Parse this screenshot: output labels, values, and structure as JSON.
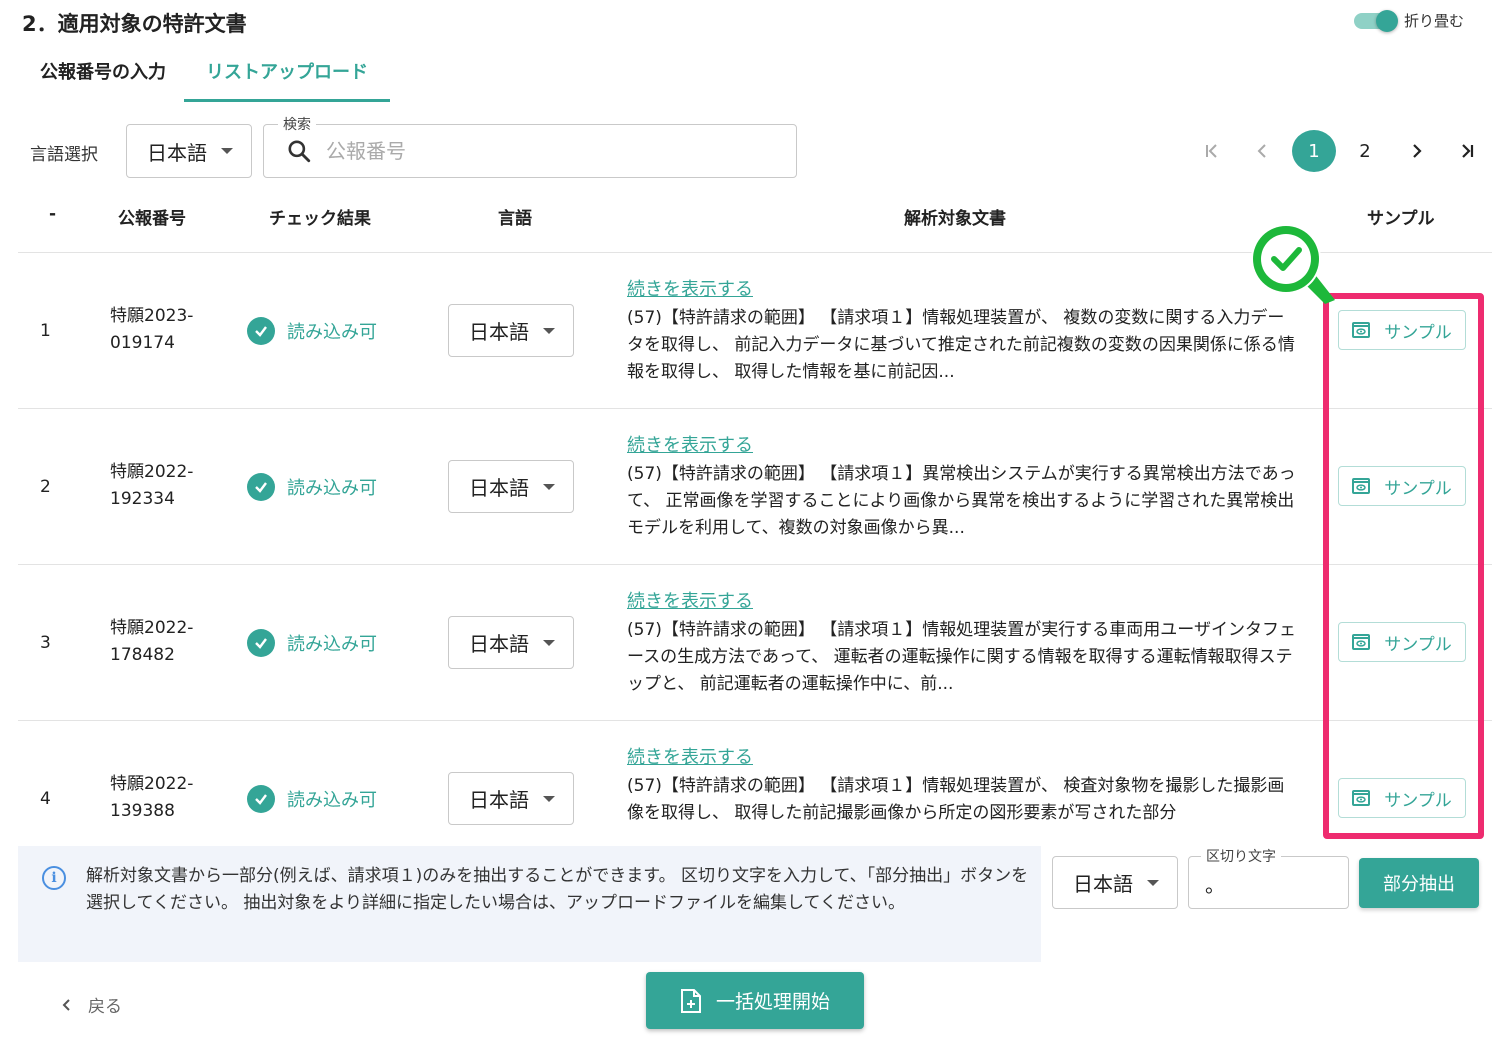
{
  "section_title": "2．適用対象の特許文書",
  "collapse_label": "折り畳む",
  "tabs": [
    {
      "label": "公報番号の入力",
      "active": false
    },
    {
      "label": "リストアップロード",
      "active": true
    }
  ],
  "filters": {
    "language_label": "言語選択",
    "language_value": "日本語",
    "search_legend": "検索",
    "search_placeholder": "公報番号"
  },
  "pagination": {
    "first": "|<",
    "prev": "<",
    "pages": [
      "1",
      "2"
    ],
    "current": "1",
    "next": ">",
    "last": ">|"
  },
  "table": {
    "columns": [
      "-",
      "公報番号",
      "チェック結果",
      "言語",
      "解析対象文書",
      "サンプル"
    ],
    "rows": [
      {
        "index": "1",
        "pub_line1": "特願2023-",
        "pub_line2": "019174",
        "status": "読み込み可",
        "language": "日本語",
        "show_more": "続きを表示する",
        "doc": "(57)【特許請求の範囲】 【請求項１】情報処理装置が、 複数の変数に関する入力データを取得し、 前記入力データに基づいて推定された前記複数の変数の因果関係に係る情報を取得し、 取得した情報を基に前記因...",
        "sample": "サンプル"
      },
      {
        "index": "2",
        "pub_line1": "特願2022-",
        "pub_line2": "192334",
        "status": "読み込み可",
        "language": "日本語",
        "show_more": "続きを表示する",
        "doc": "(57)【特許請求の範囲】 【請求項１】異常検出システムが実行する異常検出方法であって、 正常画像を学習することにより画像から異常を検出するように学習された異常検出モデルを利用して、複数の対象画像から異...",
        "sample": "サンプル"
      },
      {
        "index": "3",
        "pub_line1": "特願2022-",
        "pub_line2": "178482",
        "status": "読み込み可",
        "language": "日本語",
        "show_more": "続きを表示する",
        "doc": "(57)【特許請求の範囲】 【請求項１】情報処理装置が実行する車両用ユーザインタフェースの生成方法であって、 運転者の運転操作に関する情報を取得する運転情報取得ステップと、 前記運転者の運転操作中に、前...",
        "sample": "サンプル"
      },
      {
        "index": "4",
        "pub_line1": "特願2022-",
        "pub_line2": "139388",
        "status": "読み込み可",
        "language": "日本語",
        "show_more": "続きを表示する",
        "doc": "(57)【特許請求の範囲】 【請求項１】情報処理装置が、 検査対象物を撮影した撮影画像を取得し、 取得した前記撮影画像から所定の図形要素が写された部分",
        "sample": "サンプル"
      }
    ]
  },
  "info": {
    "text": "解析対象文書から一部分(例えば、請求項１)のみを抽出することができます。 区切り文字を入力して、「部分抽出」ボタンを選択してください。 抽出対象をより詳細に指定したい場合は、アップロードファイルを編集してください。"
  },
  "extract": {
    "language_value": "日本語",
    "delimiter_legend": "区切り文字",
    "delimiter_value": "。",
    "button_label": "部分抽出"
  },
  "footer": {
    "back_label": "戻る",
    "batch_label": "一括処理開始"
  },
  "colors": {
    "accent": "#34a597",
    "highlight": "#ee2b6f",
    "annotation_green": "#1db83a",
    "info_bg": "#f1f4fa"
  }
}
